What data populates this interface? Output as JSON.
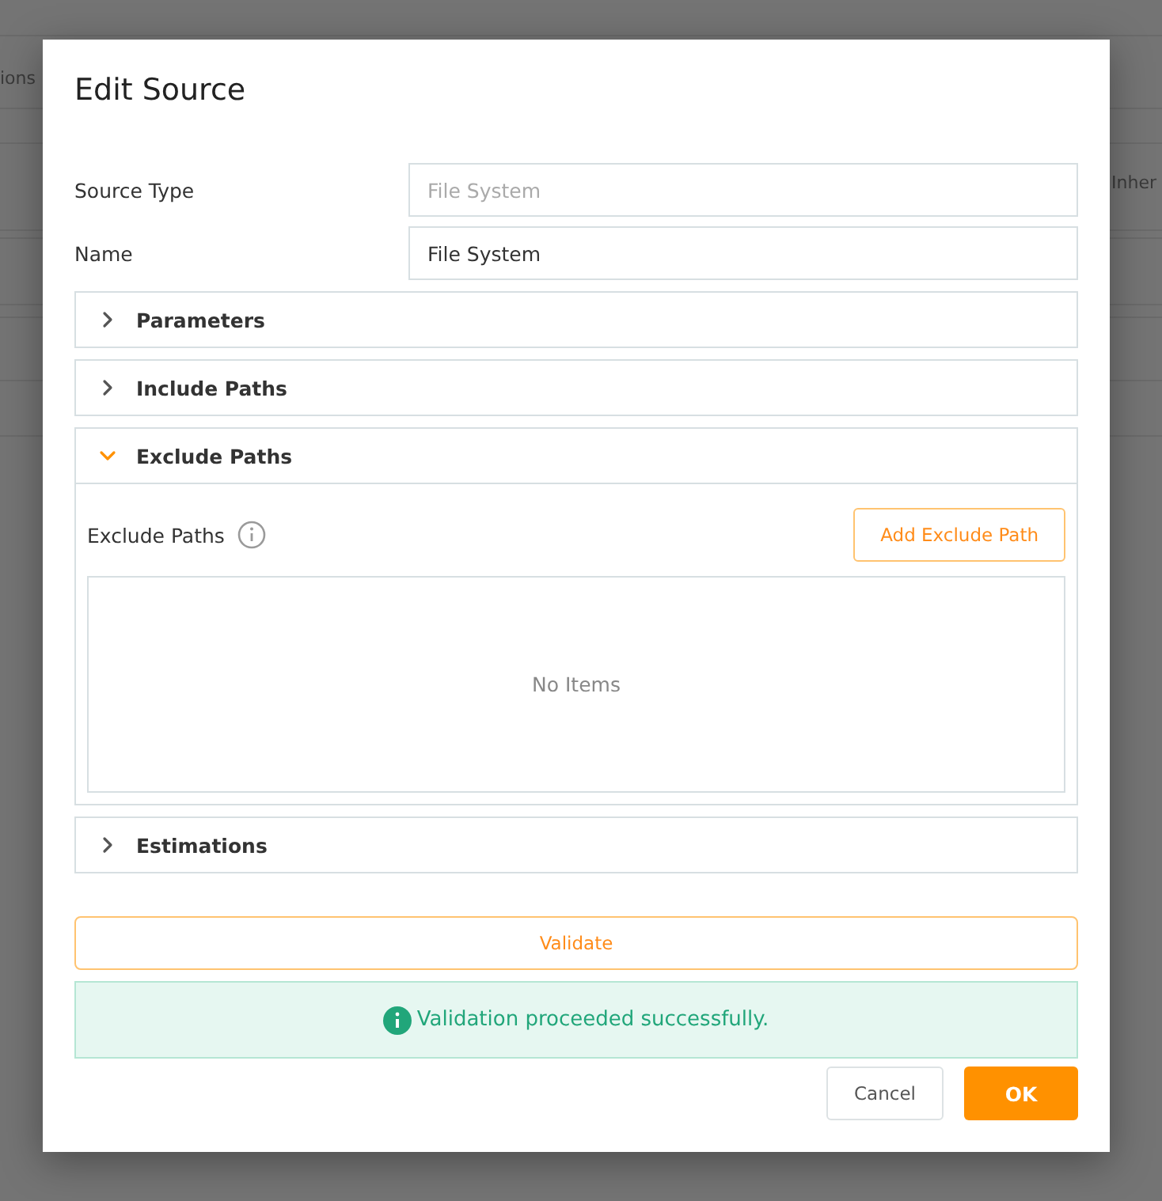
{
  "background": {
    "texts": [
      "ions",
      "Inher"
    ]
  },
  "dialog": {
    "title": "Edit Source",
    "fields": [
      {
        "label": "Source Type",
        "value": "File System",
        "disabled": true
      },
      {
        "label": "Name",
        "value": "File System",
        "disabled": false
      }
    ],
    "sections": [
      {
        "title": "Parameters",
        "expanded": false
      },
      {
        "title": "Include Paths",
        "expanded": false
      },
      {
        "title": "Exclude Paths",
        "expanded": true,
        "content": {
          "label": "Exclude Paths",
          "add_button": "Add Exclude Path",
          "empty_text": "No Items"
        }
      },
      {
        "title": "Estimations",
        "expanded": false
      }
    ],
    "validate_button": "Validate",
    "message": {
      "kind": "success",
      "text": "Validation proceeded successfully."
    },
    "buttons": {
      "cancel": "Cancel",
      "ok": "OK"
    }
  }
}
